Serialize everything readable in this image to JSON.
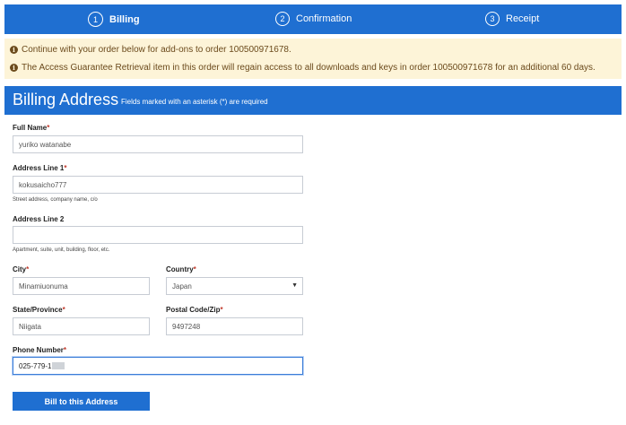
{
  "steps": [
    {
      "number": "1",
      "label": "Billing",
      "active": true
    },
    {
      "number": "2",
      "label": "Confirmation",
      "active": false
    },
    {
      "number": "3",
      "label": "Receipt",
      "active": false
    }
  ],
  "notices": [
    "Continue with your order below for add-ons to order 100500971678.",
    "The Access Guarantee Retrieval item in this order will regain access to all downloads and keys in order 100500971678 for an additional 60 days."
  ],
  "section": {
    "title": "Billing Address",
    "subtitle": "Fields marked with an asterisk (*) are required"
  },
  "form": {
    "full_name": {
      "label": "Full Name",
      "required": "*",
      "value": "yuriko watanabe"
    },
    "address1": {
      "label": "Address Line 1",
      "required": "*",
      "value": "kokusaicho777",
      "help": "Street address, company name, c/o"
    },
    "address2": {
      "label": "Address Line 2",
      "value": "",
      "help": "Apartment, suite, unit, building, floor, etc."
    },
    "city": {
      "label": "City",
      "required": "*",
      "value": "Minamiuonuma"
    },
    "country": {
      "label": "Country",
      "required": "*",
      "value": "Japan"
    },
    "state": {
      "label": "State/Province",
      "required": "*",
      "value": "Niigata"
    },
    "postal": {
      "label": "Postal Code/Zip",
      "required": "*",
      "value": "9497248"
    },
    "phone": {
      "label": "Phone Number",
      "required": "*",
      "value": "025-779-1"
    }
  },
  "submit_label": "Bill to this Address",
  "colors": {
    "accent": "#1f6fd1",
    "notice_bg": "#fdf4d8",
    "required": "#c0392b"
  }
}
